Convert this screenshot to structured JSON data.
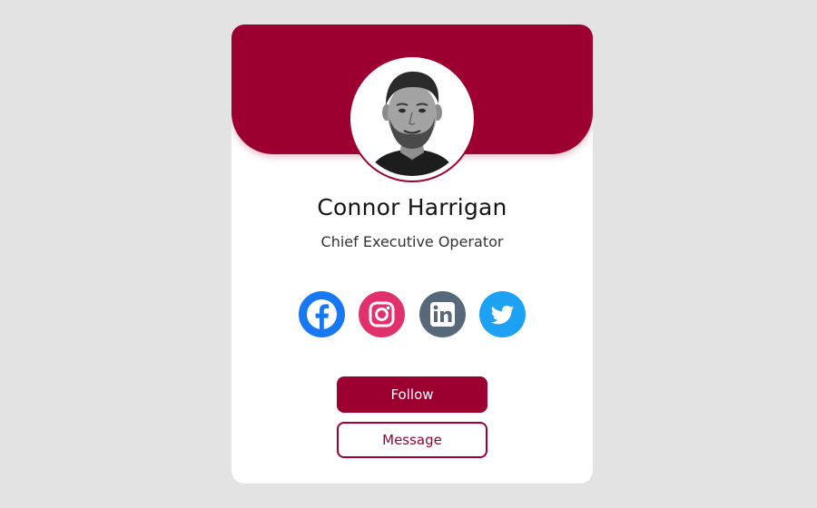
{
  "colors": {
    "background": "#e3e3e3",
    "card": "#ffffff",
    "accent": "#9b0030",
    "facebook": "#1877f2",
    "instagram": "#e1306c",
    "linkedin": "#56687a",
    "twitter": "#1da1f2"
  },
  "profile": {
    "name": "Connor Harrigan",
    "title": "Chief Executive Operator",
    "avatar_icon": "person-avatar-icon"
  },
  "socials": [
    {
      "name": "facebook",
      "icon": "facebook-icon"
    },
    {
      "name": "instagram",
      "icon": "instagram-icon"
    },
    {
      "name": "linkedin",
      "icon": "linkedin-icon"
    },
    {
      "name": "twitter",
      "icon": "twitter-icon"
    }
  ],
  "actions": {
    "follow_label": "Follow",
    "message_label": "Message"
  }
}
